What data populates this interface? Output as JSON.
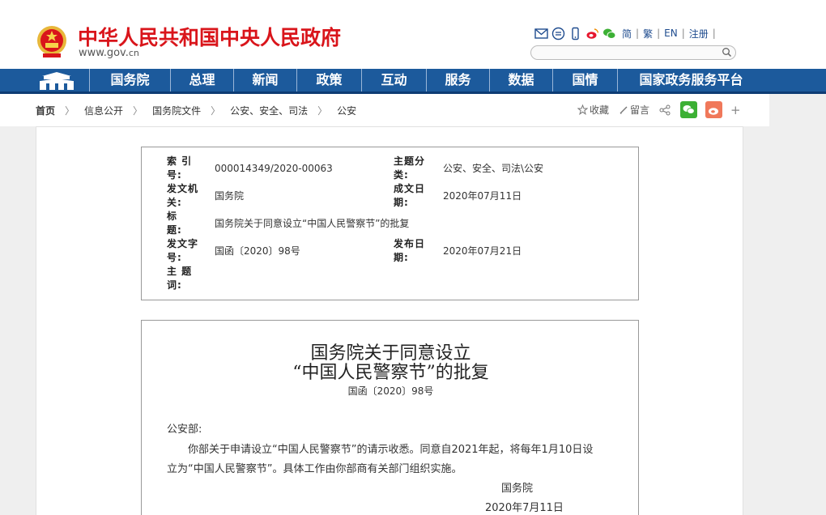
{
  "header": {
    "site_title": "中华人民共和国中央人民政府",
    "site_url_main": "www.gov.",
    "site_url_suffix": "cn",
    "tools": {
      "icons": [
        "mail-icon",
        "app-icon",
        "mobile-icon",
        "weibo-icon",
        "wechat-icon"
      ],
      "simplified": "简",
      "traditional": "繁",
      "english": "EN",
      "register": "注册",
      "separator": "|"
    },
    "search": {
      "placeholder": ""
    }
  },
  "nav": {
    "items": [
      "国务院",
      "总理",
      "新闻",
      "政策",
      "互动",
      "服务",
      "数据",
      "国情",
      "国家政务服务平台"
    ],
    "colors": {
      "bar": "#1c5a9c",
      "bar_bottom": "#0d3c74"
    }
  },
  "breadcrumb": {
    "items": [
      "首页",
      "信息公开",
      "国务院文件",
      "公安、安全、司法",
      "公安"
    ],
    "separator": "〉"
  },
  "share": {
    "favorite": "收藏",
    "comment": "留言",
    "plus": "+"
  },
  "meta": {
    "index_label": "索 引 号:",
    "index_value": "000014349/2020-00063",
    "topic_label": "主题分类:",
    "topic_value": "公安、安全、司法\\公安",
    "issuer_label": "发文机关:",
    "issuer_value": "国务院",
    "created_label": "成文日期:",
    "created_value": "2020年07月11日",
    "title_label": "标　　题:",
    "title_value": "国务院关于同意设立“中国人民警察节”的批复",
    "docno_label": "发文字号:",
    "docno_value": "国函〔2020〕98号",
    "published_label": "发布日期:",
    "published_value": "2020年07月21日",
    "keywords_label": "主 题 词:",
    "keywords_value": ""
  },
  "document": {
    "title_line1": "国务院关于同意设立",
    "title_line2": "“中国人民警察节”的批复",
    "doc_number": "国函〔2020〕98号",
    "salutation": "公安部:",
    "body_line1": "你部关于申请设立“中国人民警察节”的请示收悉。同意自2021年起，将每年1月10日设",
    "body_line2": "立为“中国人民警察节”。具体工作由你部商有关部门组织实施。",
    "signature": "国务院",
    "date": "2020年7月11日"
  },
  "colors": {
    "brand_red": "#d9151b",
    "link_blue": "#1f4c8f",
    "wechat_green": "#3cb034",
    "weibo_orange": "#f0785a"
  }
}
